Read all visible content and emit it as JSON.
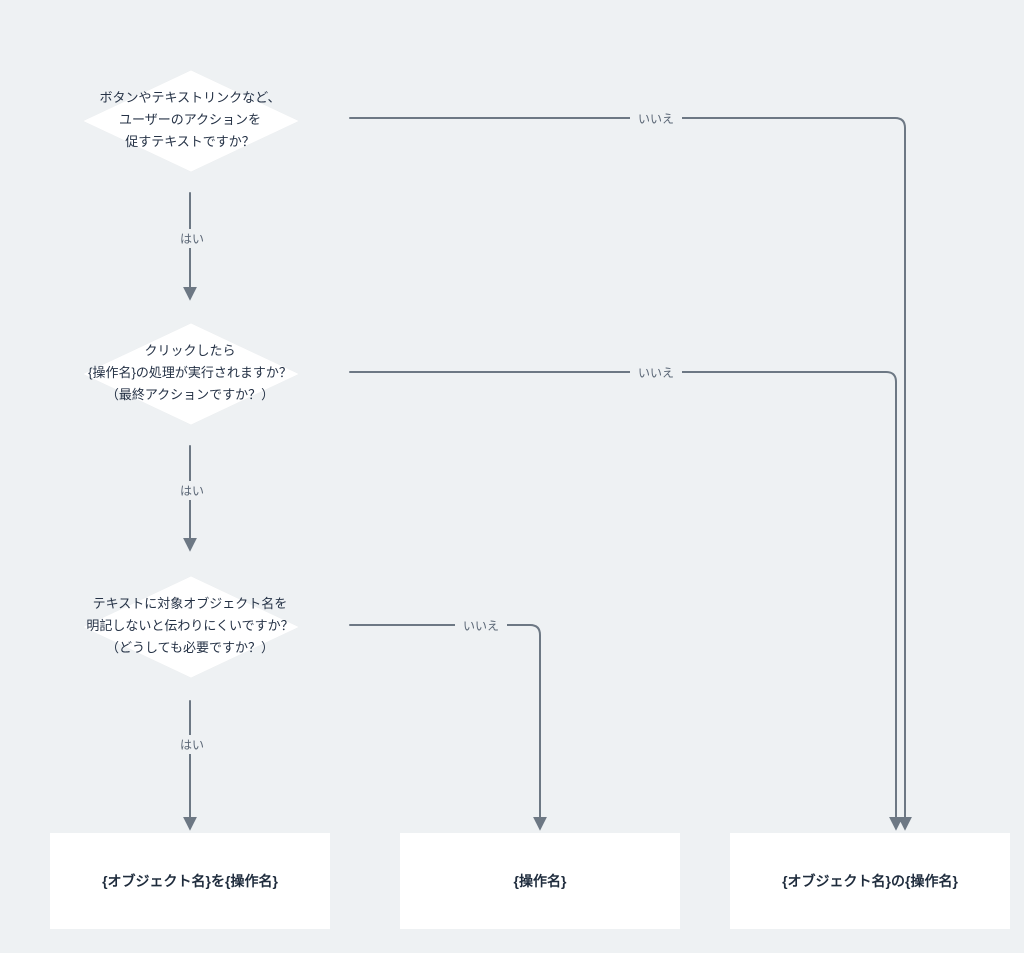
{
  "decisions": {
    "d1": "ボタンやテキストリンクなど、\nユーザーのアクションを\n促すテキストですか？",
    "d2": "クリックしたら\n{操作名}の処理が実行されますか？\n（最終アクションですか？）",
    "d3": "テキストに対象オブジェクト名を\n明記しないと伝わりにくいですか？\n（どうしても必要ですか？）"
  },
  "terminals": {
    "t1": "{オブジェクト名}を{操作名}",
    "t2": "{操作名}",
    "t3": "{オブジェクト名}の{操作名}"
  },
  "labels": {
    "yes": "はい",
    "no": "いいえ"
  },
  "colors": {
    "bg": "#eef1f3",
    "node": "#ffffff",
    "edge": "#6d7884",
    "text": "#29374a"
  }
}
